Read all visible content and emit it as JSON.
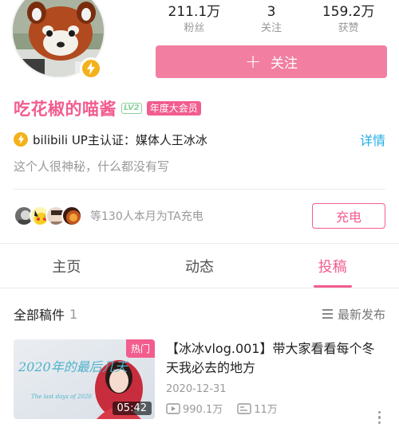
{
  "profile": {
    "name": "吃花椒的喵酱",
    "level": "LV2",
    "vip_badge": "年度大会员",
    "certification": "bilibili UP主认证：媒体人王冰冰",
    "details_label": "详情",
    "sign": "这个人很神秘，什么都没有写"
  },
  "stats": [
    {
      "value": "211.1万",
      "label": "粉丝"
    },
    {
      "value": "3",
      "label": "关注"
    },
    {
      "value": "159.2万",
      "label": "获赞"
    }
  ],
  "follow_button": {
    "icon": "plus-icon",
    "label": "关注"
  },
  "charge": {
    "text": "等130人本月为TA充电",
    "button_label": "充电"
  },
  "tabs": [
    {
      "label": "主页",
      "active": false
    },
    {
      "label": "动态",
      "active": false
    },
    {
      "label": "投稿",
      "active": true
    }
  ],
  "list": {
    "title": "全部稿件",
    "count": "1",
    "sort_label": "最新发布"
  },
  "video": {
    "title": "【冰冰vlog.001】带大家看看每个冬天我必去的地方",
    "date": "2020-12-31",
    "hot_badge": "热门",
    "duration": "05:42",
    "views": "990.1万",
    "danmaku": "11万",
    "thumb_text": "2020年的最后几天",
    "thumb_subtext": "The last days of 2020"
  },
  "colors": {
    "accent": "#f25d8e",
    "follow_bg": "#f27fa2",
    "link": "#23ade5",
    "badge_gold": "#f3b21b"
  }
}
